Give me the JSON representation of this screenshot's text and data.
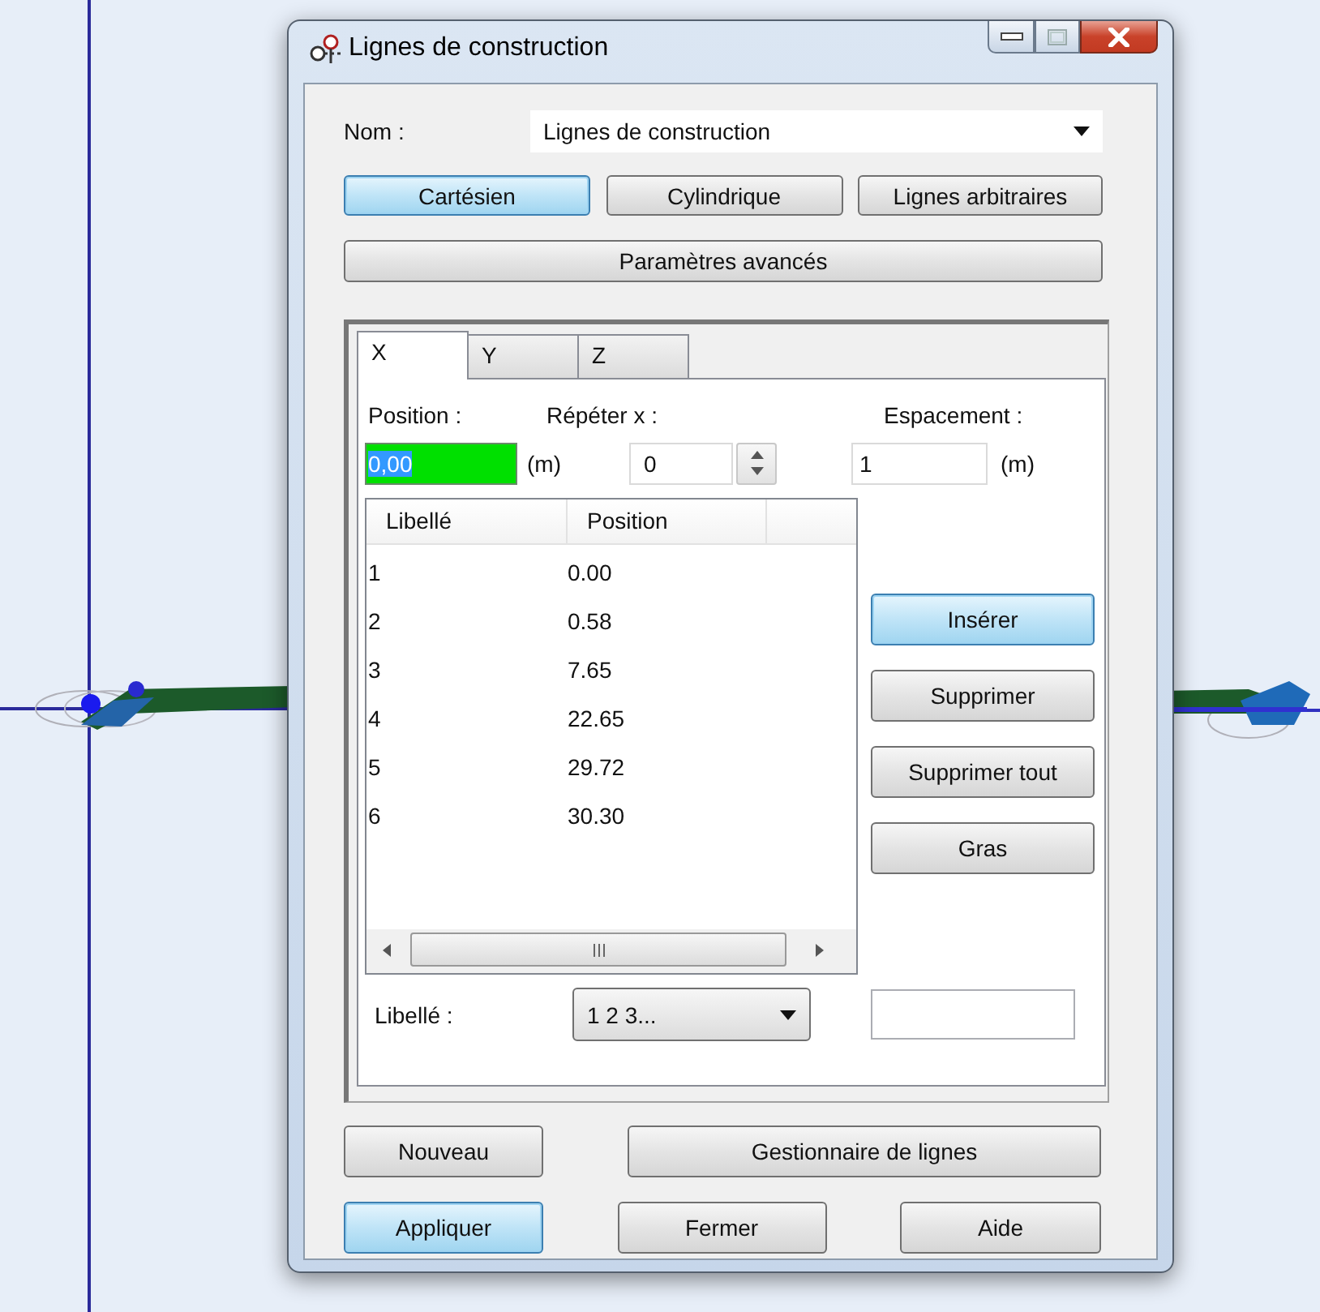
{
  "window": {
    "title": "Lignes de construction"
  },
  "name_field": {
    "label": "Nom :",
    "value": "Lignes de construction"
  },
  "modes": [
    {
      "label": "Cartésien",
      "selected": true
    },
    {
      "label": "Cylindrique",
      "selected": false
    },
    {
      "label": "Lignes arbitraires",
      "selected": false
    }
  ],
  "advanced_button": "Paramètres avancés",
  "tabs": [
    {
      "label": "X",
      "selected": true
    },
    {
      "label": "Y",
      "selected": false
    },
    {
      "label": "Z",
      "selected": false
    }
  ],
  "position": {
    "label": "Position :",
    "value": "0,00",
    "unit": "(m)",
    "highlighted": true,
    "text_selected": true
  },
  "repeat": {
    "label": "Répéter x :",
    "value": "0"
  },
  "spacing": {
    "label": "Espacement :",
    "value": "1",
    "unit": "(m)"
  },
  "table": {
    "columns": [
      "Libellé",
      "Position"
    ],
    "rows": [
      [
        "1",
        "0.00"
      ],
      [
        "2",
        "0.58"
      ],
      [
        "3",
        "7.65"
      ],
      [
        "4",
        "22.65"
      ],
      [
        "5",
        "29.72"
      ],
      [
        "6",
        "30.30"
      ]
    ]
  },
  "list_buttons": [
    {
      "label": "Insérer",
      "default": true
    },
    {
      "label": "Supprimer",
      "default": false
    },
    {
      "label": "Supprimer tout",
      "default": false
    },
    {
      "label": "Gras",
      "default": false
    }
  ],
  "label_field": {
    "label": "Libellé :",
    "value": "1 2 3..."
  },
  "footer_buttons": [
    [
      {
        "label": "Nouveau",
        "default": false
      },
      {
        "label": "Gestionnaire de lignes",
        "default": false
      }
    ],
    [
      {
        "label": "Appliquer",
        "default": true
      },
      {
        "label": "Fermer",
        "default": false
      },
      {
        "label": "Aide",
        "default": false
      }
    ]
  ]
}
